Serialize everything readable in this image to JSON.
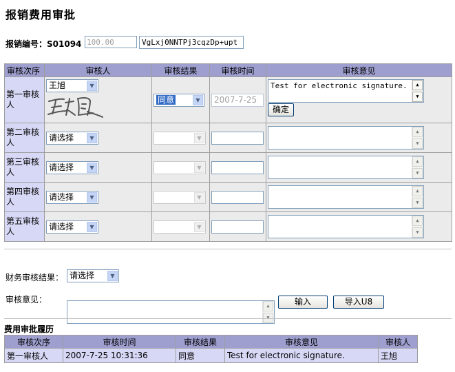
{
  "page_title": "报销费用审批",
  "expense": {
    "label": "报销编号：S01094",
    "amount_value": "100.00",
    "signature_code": "VgLxj0NNTPj3cqzDp+upt"
  },
  "grid": {
    "headers": [
      "审核次序",
      "审核人",
      "审核结果",
      "审核时间",
      "审核意见"
    ],
    "rows": [
      {
        "label": "第一审核人",
        "reviewer": "王旭",
        "result": "同意",
        "time": "2007-7-25",
        "opinion": "Test for electronic signature.",
        "confirm": "确定"
      },
      {
        "label": "第二审核人",
        "reviewer": "请选择",
        "result": "",
        "time": "",
        "opinion": ""
      },
      {
        "label": "第三审核人",
        "reviewer": "请选择",
        "result": "",
        "time": "",
        "opinion": ""
      },
      {
        "label": "第四审核人",
        "reviewer": "请选择",
        "result": "",
        "time": "",
        "opinion": ""
      },
      {
        "label": "第五审核人",
        "reviewer": "请选择",
        "result": "",
        "time": "",
        "opinion": ""
      }
    ]
  },
  "finance": {
    "result_label": "财务审核结果：",
    "result_value": "请选择",
    "opinion_label": "审核意见：",
    "input_button": "输入",
    "import_button": "导入U8"
  },
  "history": {
    "title": "费用审批履历",
    "headers": [
      "审核次序",
      "审核时间",
      "审核结果",
      "审核意见",
      "审核人"
    ],
    "rows": [
      [
        "第一审核人",
        "2007-7-25 10:31:36",
        "同意",
        "Test for electronic signature.",
        "王旭"
      ]
    ]
  },
  "colors": {
    "header_bg": "#9e9fcf",
    "row_label_bg": "#d7d8f5",
    "cell_bg": "#ebebeb"
  }
}
